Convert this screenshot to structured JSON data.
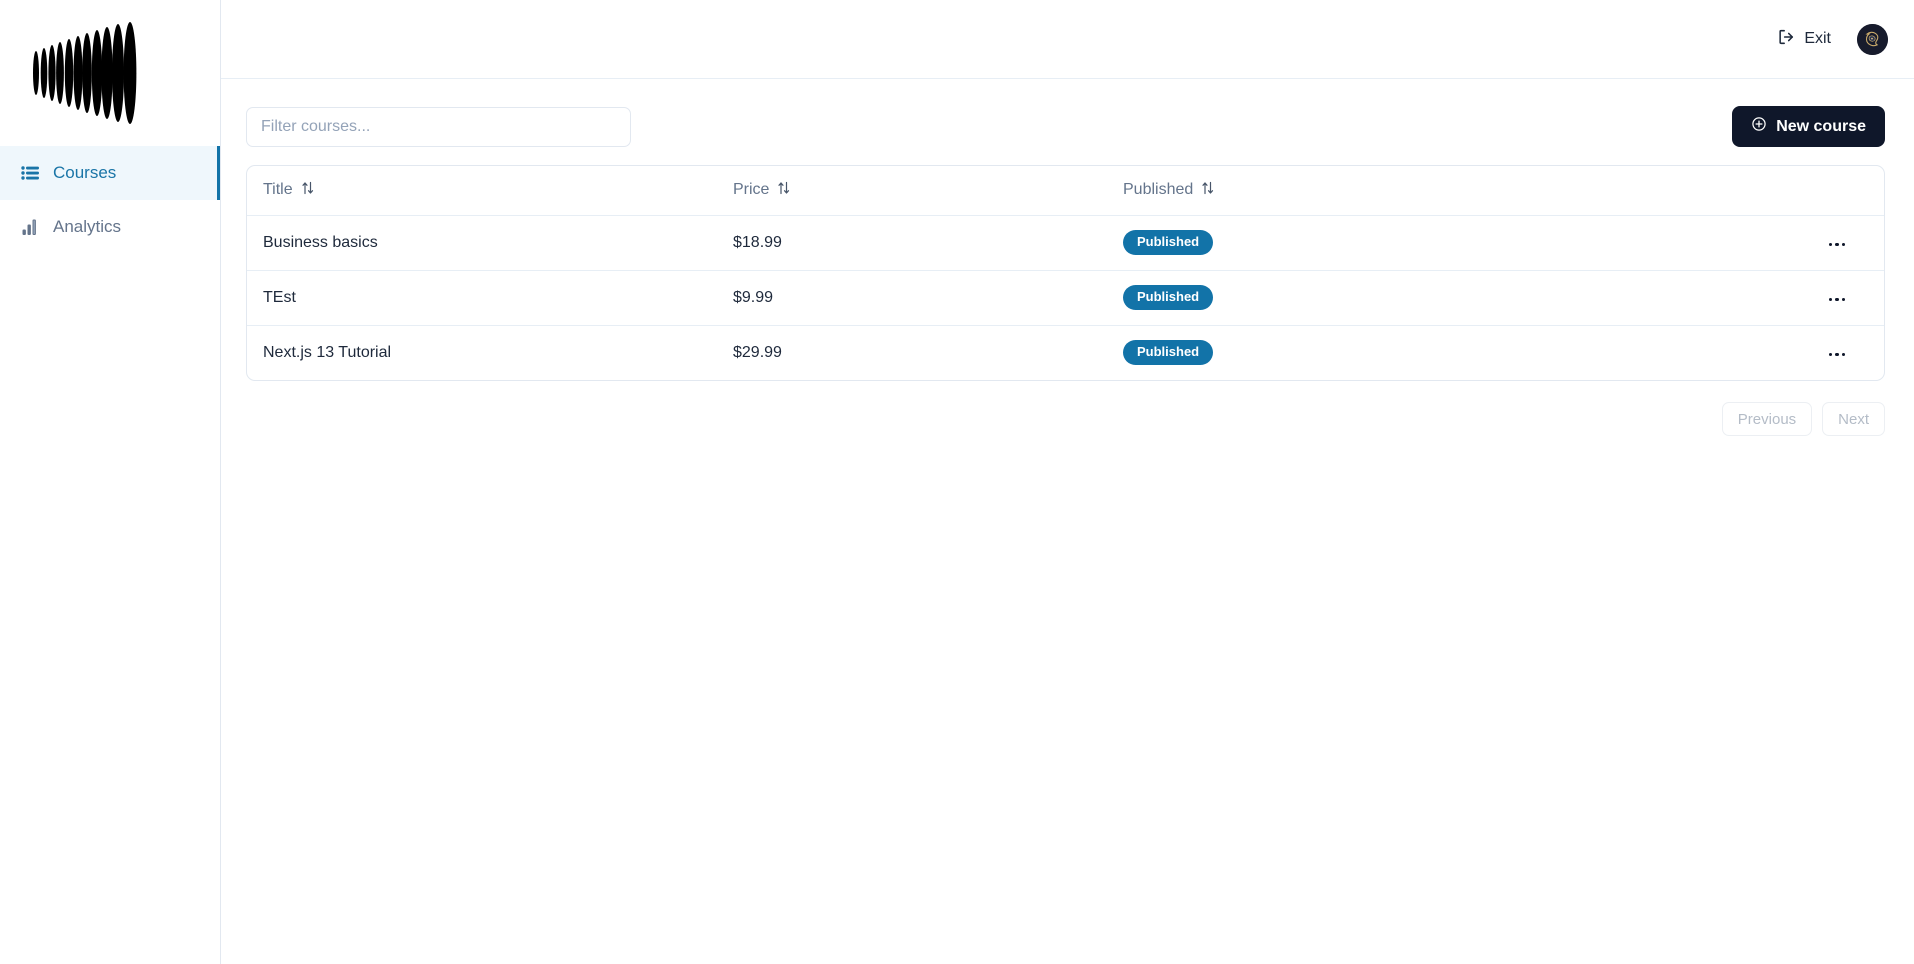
{
  "sidebar": {
    "logo_name": "sound-wave-logo",
    "items": [
      {
        "label": "Courses",
        "icon": "list-icon",
        "active": true
      },
      {
        "label": "Analytics",
        "icon": "bar-chart-icon",
        "active": false
      }
    ]
  },
  "topbar": {
    "exit_label": "Exit",
    "exit_icon": "logout-icon",
    "avatar_alt": "user-avatar"
  },
  "toolbar": {
    "filter_placeholder": "Filter courses...",
    "filter_value": "",
    "new_course_label": "New course",
    "new_course_icon": "plus-circle-icon"
  },
  "table": {
    "columns": [
      {
        "label": "Title",
        "sort_icon": "sort-arrows-icon"
      },
      {
        "label": "Price",
        "sort_icon": "sort-arrows-icon"
      },
      {
        "label": "Published",
        "sort_icon": "sort-arrows-icon"
      }
    ],
    "rows": [
      {
        "title": "Business basics",
        "price": "$18.99",
        "status": "Published"
      },
      {
        "title": "TEst",
        "price": "$9.99",
        "status": "Published"
      },
      {
        "title": "Next.js 13 Tutorial",
        "price": "$29.99",
        "status": "Published"
      }
    ],
    "row_menu_icon": "more-horizontal-icon"
  },
  "pagination": {
    "previous_label": "Previous",
    "next_label": "Next"
  },
  "colors": {
    "accent_blue": "#1273a8",
    "active_nav_bg": "#eff7fc",
    "dark_button": "#0f172a",
    "badge_blue": "#1273a8",
    "border": "#e2e8f0",
    "muted_text": "#64748b"
  }
}
